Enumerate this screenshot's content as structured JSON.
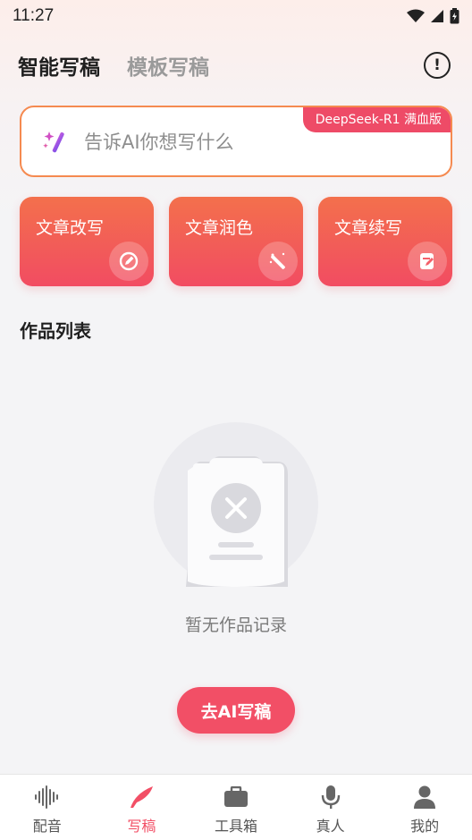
{
  "status_bar": {
    "time": "11:27"
  },
  "header": {
    "tabs": [
      {
        "label": "智能写稿",
        "active": true
      },
      {
        "label": "模板写稿",
        "active": false
      }
    ],
    "info_icon": "info-circle-icon"
  },
  "prompt": {
    "placeholder": "告诉AI你想写什么",
    "badge": "DeepSeek-R1 满血版",
    "icon": "magic-wand-icon",
    "border_color": "#f58a50"
  },
  "features": [
    {
      "label": "文章改写",
      "icon": "pen-circle-icon"
    },
    {
      "label": "文章润色",
      "icon": "magic-wand-sparkle-icon"
    },
    {
      "label": "文章续写",
      "icon": "document-edit-icon"
    }
  ],
  "works": {
    "title": "作品列表",
    "empty_text": "暂无作品记录",
    "cta_label": "去AI写稿"
  },
  "bottom_nav": [
    {
      "label": "配音",
      "icon": "sound-wave-icon",
      "active": false
    },
    {
      "label": "写稿",
      "icon": "feather-icon",
      "active": true
    },
    {
      "label": "工具箱",
      "icon": "toolbox-icon",
      "active": false
    },
    {
      "label": "真人",
      "icon": "microphone-icon",
      "active": false
    },
    {
      "label": "我的",
      "icon": "user-icon",
      "active": false
    }
  ],
  "colors": {
    "accent": "#f24f66",
    "card_gradient_top": "#f3704c",
    "card_gradient_bottom": "#f24c62"
  }
}
